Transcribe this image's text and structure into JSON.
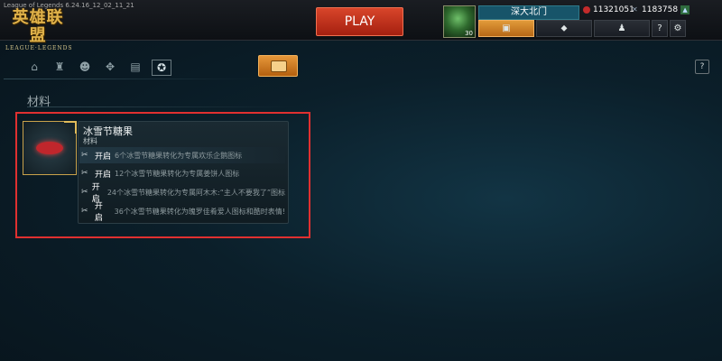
{
  "window": {
    "version": "League of Legends 6.24.16_12_02_11_21"
  },
  "logo": {
    "main": "英雄联盟",
    "sub": "LEAGUE·LEGENDS"
  },
  "top": {
    "play_label": "PLAY",
    "summoner_name": "深大北门",
    "level": "30",
    "rp": "11321051",
    "ip": "1183758"
  },
  "subnav": {
    "help": "?"
  },
  "section": {
    "title": "材料"
  },
  "item": {
    "name": "冰雪节糖果",
    "type": "材料",
    "options": [
      {
        "button": "开启",
        "desc": "6个冰雪节糖果转化为专属欢乐企鹅图标"
      },
      {
        "button": "开启",
        "desc": "12个冰雪节糖果转化为专属姜饼人图标"
      },
      {
        "button": "开启",
        "desc": "24个冰雪节糖果转化为专属阿木木:“主人不要我了”图标"
      },
      {
        "button": "开启",
        "desc": "36个冰雪节糖果转化为魄罗佳肴爱人图标和酷时表情!"
      }
    ]
  },
  "icons": {
    "topnav": [
      "chest-icon",
      "loot-icon",
      "profile-icon",
      "help-icon",
      "settings-icon"
    ],
    "subnav": [
      "home-icon",
      "champion-icon",
      "skin-icon",
      "ward-icon",
      "profile-card-icon",
      "crafting-icon"
    ]
  }
}
